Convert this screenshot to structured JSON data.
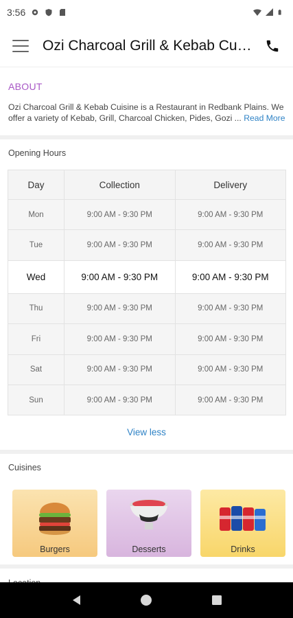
{
  "status_bar": {
    "time": "3:56",
    "icons": [
      "gear-icon",
      "shield-icon",
      "sd-card-icon",
      "wifi-icon",
      "signal-icon",
      "battery-icon"
    ]
  },
  "app_bar": {
    "menu_icon": "hamburger-icon",
    "title": "Ozi Charcoal Grill & Kebab Cuisine",
    "call_icon": "phone-icon"
  },
  "about": {
    "heading": "ABOUT",
    "text": "Ozi Charcoal Grill & Kebab Cuisine is a Restaurant in Redbank Plains. We offer a variety of Kebab, Grill, Charcoal Chicken, Pides, Gozi ...",
    "read_more": "Read More"
  },
  "opening_hours": {
    "label": "Opening Hours",
    "columns": [
      "Day",
      "Collection",
      "Delivery"
    ],
    "rows": [
      {
        "day": "Mon",
        "collection": "9:00 AM - 9:30 PM",
        "delivery": "9:00 AM - 9:30 PM"
      },
      {
        "day": "Tue",
        "collection": "9:00 AM - 9:30 PM",
        "delivery": "9:00 AM - 9:30 PM"
      },
      {
        "day": "Wed",
        "collection": "9:00 AM - 9:30 PM",
        "delivery": "9:00 AM - 9:30 PM"
      },
      {
        "day": "Thu",
        "collection": "9:00 AM - 9:30 PM",
        "delivery": "9:00 AM - 9:30 PM"
      },
      {
        "day": "Fri",
        "collection": "9:00 AM - 9:30 PM",
        "delivery": "9:00 AM - 9:30 PM"
      },
      {
        "day": "Sat",
        "collection": "9:00 AM - 9:30 PM",
        "delivery": "9:00 AM - 9:30 PM"
      },
      {
        "day": "Sun",
        "collection": "9:00 AM - 9:30 PM",
        "delivery": "9:00 AM - 9:30 PM"
      }
    ],
    "view_less": "View less"
  },
  "cuisines": {
    "label": "Cuisines",
    "items": [
      {
        "label": "Burgers",
        "icon": "burger-icon"
      },
      {
        "label": "Desserts",
        "icon": "dessert-icon"
      },
      {
        "label": "Drinks",
        "icon": "drinks-icon"
      }
    ]
  },
  "location": {
    "label": "Location"
  },
  "nav_bar": {
    "icons": [
      "back-icon",
      "home-icon",
      "recents-icon"
    ]
  },
  "colors": {
    "accent": "#a857c6",
    "link": "#2f83c6"
  }
}
